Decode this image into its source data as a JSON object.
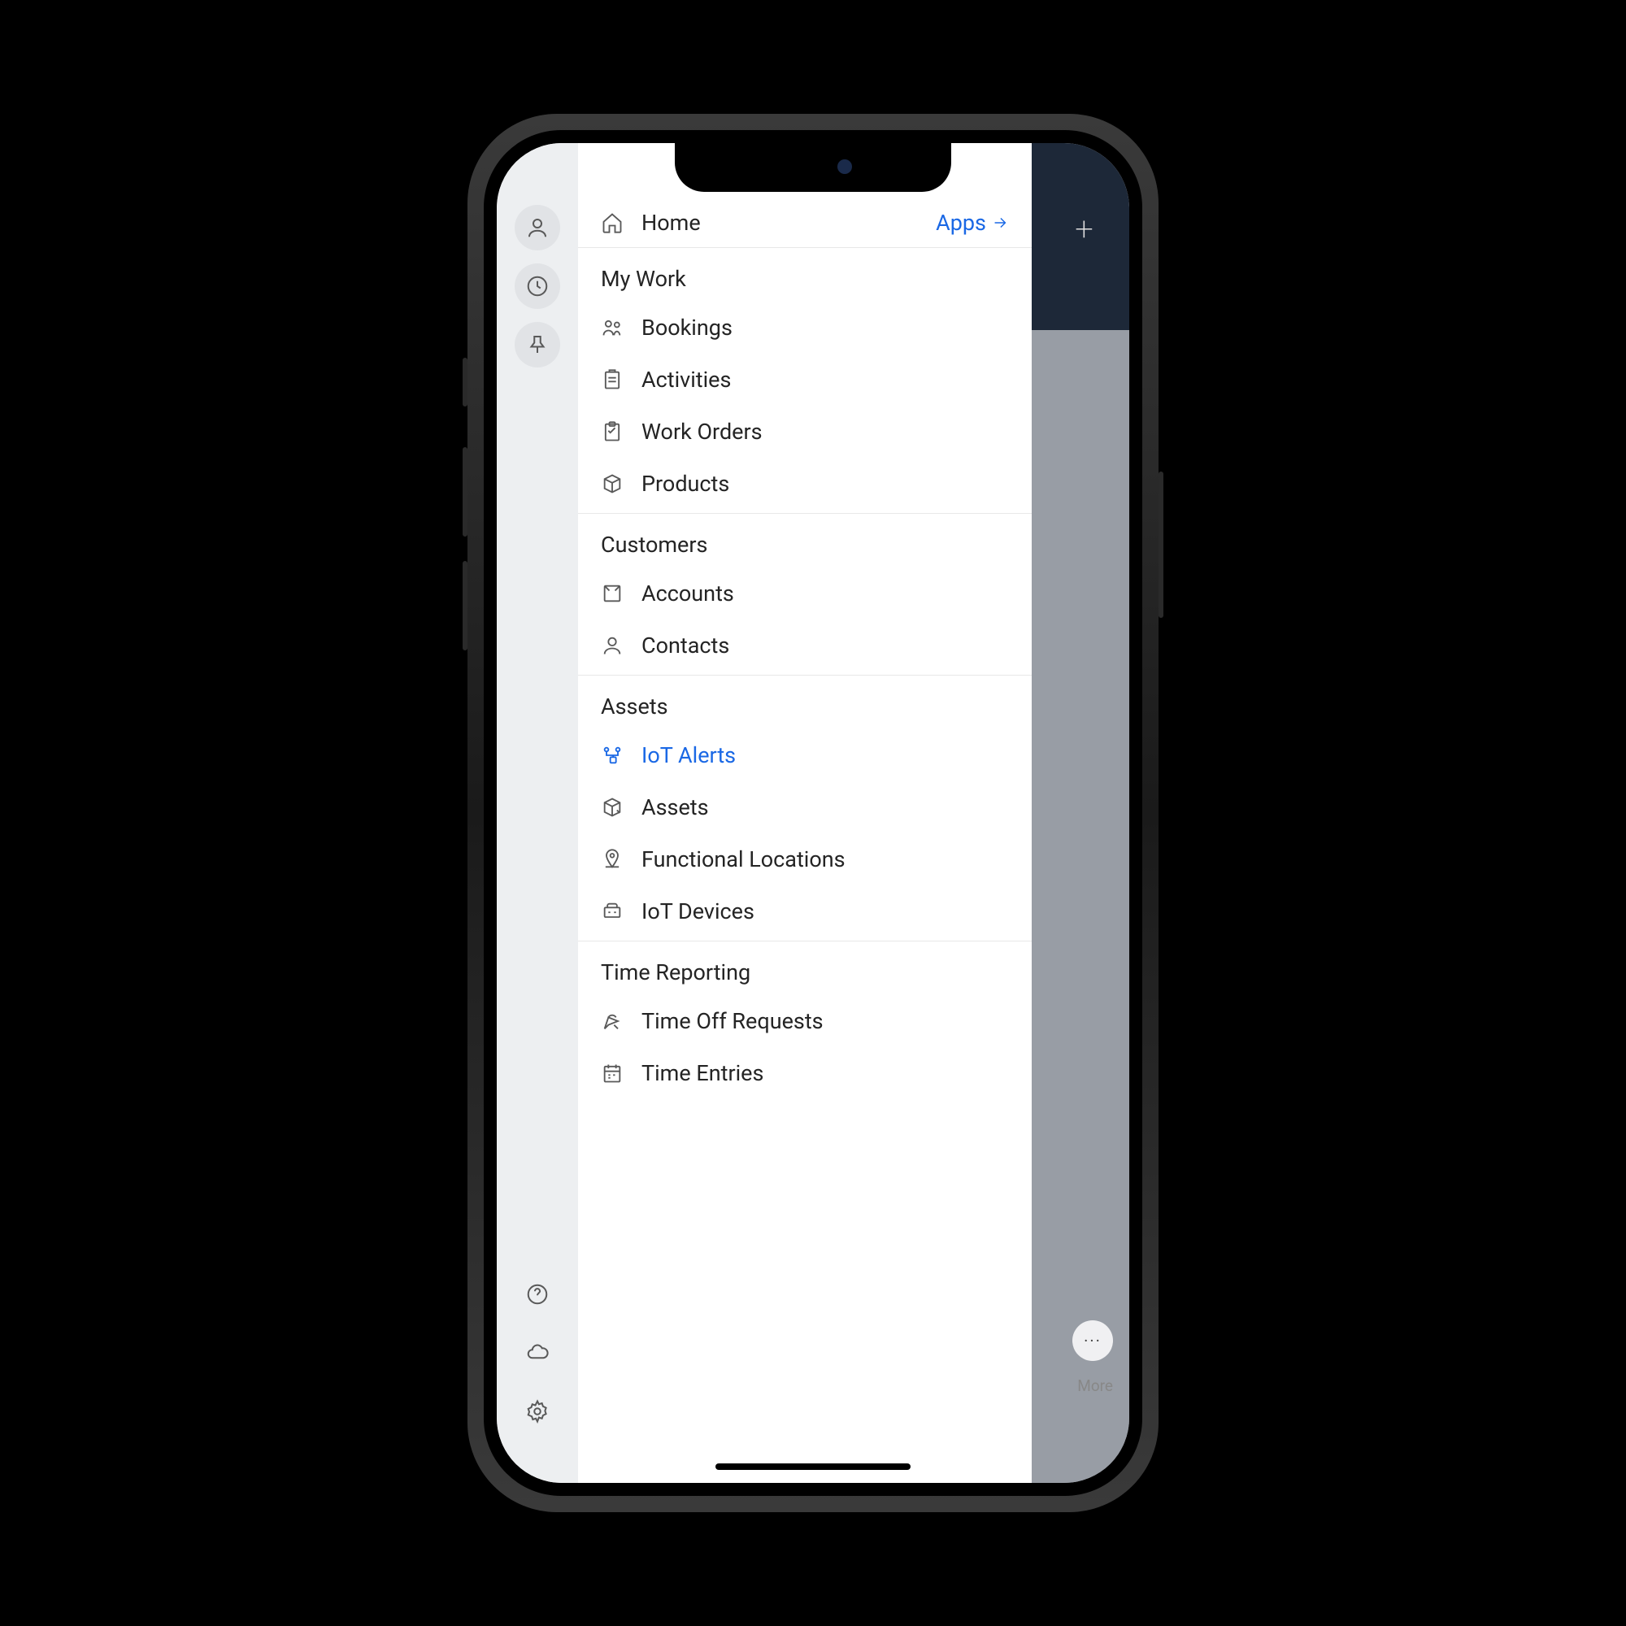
{
  "home": {
    "label": "Home",
    "apps_label": "Apps"
  },
  "sections": [
    {
      "header": "My Work",
      "items": [
        {
          "label": "Bookings"
        },
        {
          "label": "Activities"
        },
        {
          "label": "Work Orders"
        },
        {
          "label": "Products"
        }
      ]
    },
    {
      "header": "Customers",
      "items": [
        {
          "label": "Accounts"
        },
        {
          "label": "Contacts"
        }
      ]
    },
    {
      "header": "Assets",
      "items": [
        {
          "label": "IoT Alerts"
        },
        {
          "label": "Assets"
        },
        {
          "label": "Functional Locations"
        },
        {
          "label": "IoT Devices"
        }
      ]
    },
    {
      "header": "Time Reporting",
      "items": [
        {
          "label": "Time Off Requests"
        },
        {
          "label": "Time Entries"
        }
      ]
    }
  ],
  "backdrop": {
    "more_label": "More"
  }
}
